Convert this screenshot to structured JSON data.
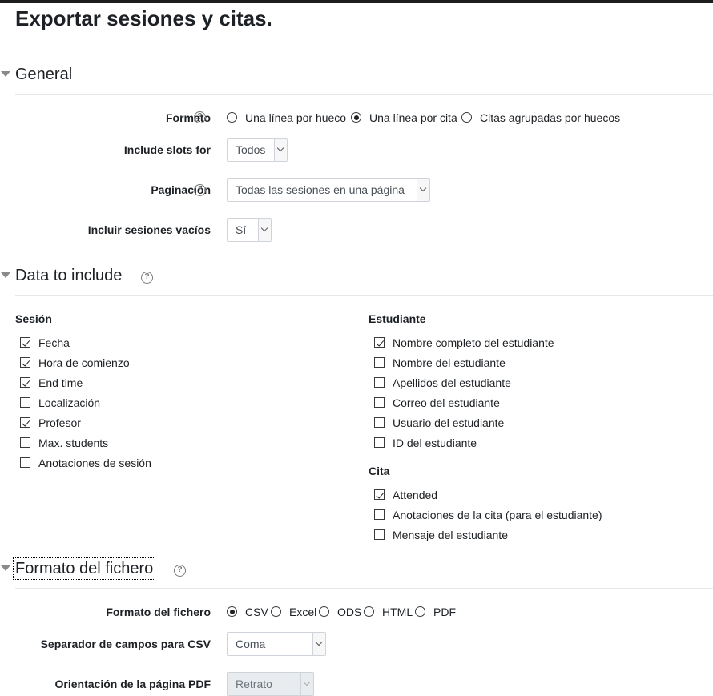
{
  "page_title": "Exportar sesiones y citas.",
  "sections": {
    "general": {
      "title": "General",
      "formato": {
        "label": "Formato",
        "options": [
          "Una línea por hueco",
          "Una línea por cita",
          "Citas agrupadas por huecos"
        ],
        "selected": "Una línea por cita"
      },
      "include_slots": {
        "label": "Include slots for",
        "value": "Todos"
      },
      "paginacion": {
        "label": "Paginación",
        "value": "Todas las sesiones en una página"
      },
      "incluir_vacios": {
        "label": "Incluir sesiones vacíos",
        "value": "Sí"
      }
    },
    "data_include": {
      "title": "Data to include",
      "sesion": {
        "title": "Sesión",
        "items": [
          {
            "label": "Fecha",
            "checked": true
          },
          {
            "label": "Hora de comienzo",
            "checked": true
          },
          {
            "label": "End time",
            "checked": true
          },
          {
            "label": "Localización",
            "checked": false
          },
          {
            "label": "Profesor",
            "checked": true
          },
          {
            "label": "Max. students",
            "checked": false
          },
          {
            "label": "Anotaciones de sesión",
            "checked": false
          }
        ]
      },
      "estudiante": {
        "title": "Estudiante",
        "items": [
          {
            "label": "Nombre completo del estudiante",
            "checked": true
          },
          {
            "label": "Nombre del estudiante",
            "checked": false
          },
          {
            "label": "Apellidos del estudiante",
            "checked": false
          },
          {
            "label": "Correo del estudiante",
            "checked": false
          },
          {
            "label": "Usuario del estudiante",
            "checked": false
          },
          {
            "label": "ID del estudiante",
            "checked": false
          }
        ]
      },
      "cita": {
        "title": "Cita",
        "items": [
          {
            "label": "Attended",
            "checked": true
          },
          {
            "label": "Anotaciones de la cita (para el estudiante)",
            "checked": false
          },
          {
            "label": "Mensaje del estudiante",
            "checked": false
          }
        ]
      }
    },
    "formato_fichero": {
      "title": "Formato del fichero",
      "file_format": {
        "label": "Formato del fichero",
        "options": [
          "CSV",
          "Excel",
          "ODS",
          "HTML",
          "PDF"
        ],
        "selected": "CSV"
      },
      "separador": {
        "label": "Separador de campos para CSV",
        "value": "Coma"
      },
      "orientacion": {
        "label": "Orientación de la página PDF",
        "value": "Retrato",
        "disabled": true
      }
    }
  },
  "help_icon_glyph": "?",
  "colors": {
    "text": "#1d2125",
    "border": "#ced4da",
    "icon": "#7a7a7a"
  }
}
